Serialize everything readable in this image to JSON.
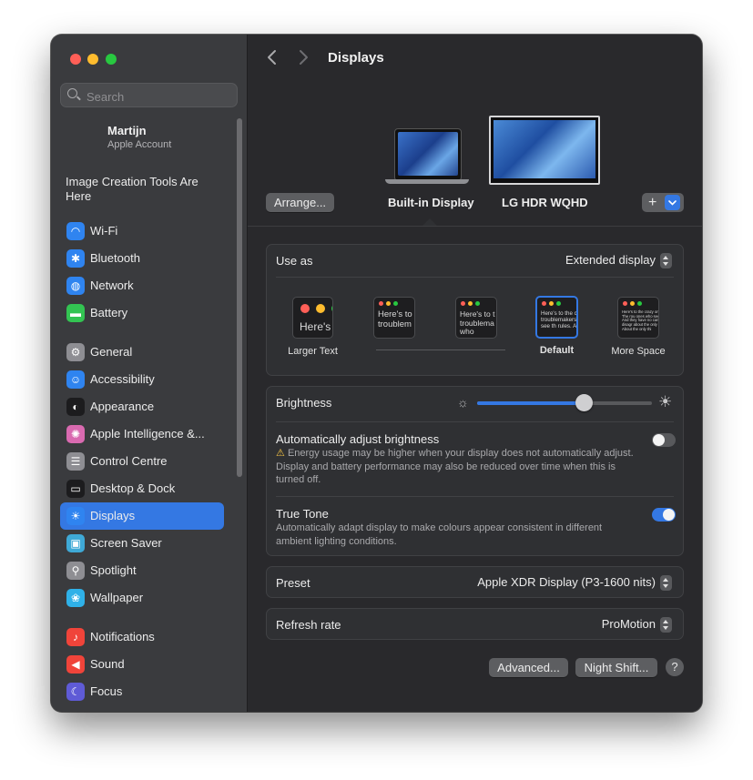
{
  "window": {
    "traffic_lights": {
      "close": "#ff5f57",
      "minimize": "#febc2e",
      "zoom": "#28c840"
    }
  },
  "sidebar": {
    "search_placeholder": "Search",
    "account": {
      "name": "Martijn",
      "subtitle": "Apple Account"
    },
    "promo_text": "Image Creation Tools Are Here",
    "items": [
      {
        "label": "Wi-Fi",
        "icon": "wifi-icon",
        "color": "#2f84f0",
        "glyph": "◠"
      },
      {
        "label": "Bluetooth",
        "icon": "bluetooth-icon",
        "color": "#2f84f0",
        "glyph": "✱"
      },
      {
        "label": "Network",
        "icon": "globe-icon",
        "color": "#2f84f0",
        "glyph": "◍"
      },
      {
        "label": "Battery",
        "icon": "battery-icon",
        "color": "#33c452",
        "glyph": "▬"
      },
      {
        "label": "General",
        "icon": "gear-icon",
        "color": "#8e8e93",
        "glyph": "⚙"
      },
      {
        "label": "Accessibility",
        "icon": "accessibility-icon",
        "color": "#2f84f0",
        "glyph": "☺"
      },
      {
        "label": "Appearance",
        "icon": "appearance-icon",
        "color": "#1c1c1e",
        "glyph": "◐"
      },
      {
        "label": "Apple Intelligence &...",
        "icon": "apple-intelligence-icon",
        "color": "#d96ab0",
        "glyph": "✺"
      },
      {
        "label": "Control Centre",
        "icon": "control-centre-icon",
        "color": "#8e8e93",
        "glyph": "☰"
      },
      {
        "label": "Desktop & Dock",
        "icon": "dock-icon",
        "color": "#1c1c1e",
        "glyph": "▭"
      },
      {
        "label": "Displays",
        "icon": "sun-icon",
        "color": "#2f84f0",
        "glyph": "☀"
      },
      {
        "label": "Screen Saver",
        "icon": "screen-saver-icon",
        "color": "#3fa9d6",
        "glyph": "▣"
      },
      {
        "label": "Spotlight",
        "icon": "spotlight-icon",
        "color": "#8e8e93",
        "glyph": "⚲"
      },
      {
        "label": "Wallpaper",
        "icon": "wallpaper-icon",
        "color": "#2fb1e8",
        "glyph": "❀"
      },
      {
        "label": "Notifications",
        "icon": "bell-icon",
        "color": "#f0443a",
        "glyph": "♪"
      },
      {
        "label": "Sound",
        "icon": "speaker-icon",
        "color": "#f0443a",
        "glyph": "◀"
      },
      {
        "label": "Focus",
        "icon": "moon-icon",
        "color": "#5f5bd6",
        "glyph": "☾"
      }
    ],
    "active_item": "Displays"
  },
  "header": {
    "title": "Displays"
  },
  "arrangement": {
    "arrange_button": "Arrange...",
    "displays": [
      "Built-in Display",
      "LG HDR WQHD"
    ],
    "selected": "Built-in Display"
  },
  "use_as": {
    "label": "Use as",
    "value": "Extended display",
    "resolutions": [
      {
        "label": "Larger Text",
        "sample": "Here's"
      },
      {
        "label": "",
        "sample": "Here's to troublem"
      },
      {
        "label": "",
        "sample": "Here's to t troublema ones who"
      },
      {
        "label": "Default",
        "sample": "Here's to the cr troublemakers ones who see th rules. And they"
      },
      {
        "label": "More Space",
        "sample": "Here's to the crazy ones troublemakers. The rou ones who see things diff rules. And they have no can quote them, disagr about the only thing yo them. About the only thi"
      }
    ],
    "selected_resolution": "Default"
  },
  "brightness": {
    "label": "Brightness",
    "level_percent": 61,
    "auto_label": "Automatically adjust brightness",
    "auto_enabled": false,
    "auto_warning": "Energy usage may be higher when your display does not automatically adjust. Display and battery performance may also be reduced over time when this is turned off.",
    "true_tone_label": "True Tone",
    "true_tone_enabled": true,
    "true_tone_desc": "Automatically adapt display to make colours appear consistent in different ambient lighting conditions."
  },
  "preset": {
    "label": "Preset",
    "value": "Apple XDR Display (P3-1600 nits)"
  },
  "refresh_rate": {
    "label": "Refresh rate",
    "value": "ProMotion"
  },
  "footer": {
    "advanced_button": "Advanced...",
    "night_shift_button": "Night Shift...",
    "help_button": "?"
  },
  "colors": {
    "accent": "#3478e3",
    "toggle_off": "#58595c"
  }
}
